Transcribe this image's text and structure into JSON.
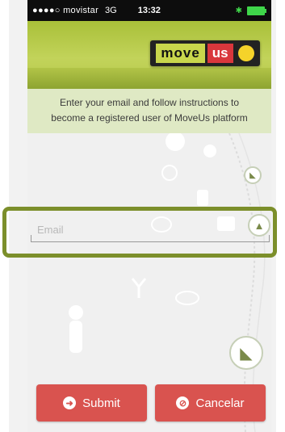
{
  "status_bar": {
    "carrier": "●●●●○ movistar",
    "network": "3G",
    "time": "13:32"
  },
  "header": {
    "logo_move": "move",
    "logo_us": "us"
  },
  "instructions": {
    "line1": "Enter your email and follow instructions to",
    "line2": "become a registered user of MoveUs platform"
  },
  "form": {
    "email_placeholder": "Email"
  },
  "buttons": {
    "submit_label": "Submit",
    "cancel_label": "Cancelar"
  },
  "icons": {
    "submit": "arrow-right-circle-icon",
    "cancel": "ban-icon"
  },
  "colors": {
    "header_green": "#b5c84a",
    "instruction_bg": "#dfe9c4",
    "button_red": "#d9534f",
    "highlight_green": "#7c8f2b"
  }
}
